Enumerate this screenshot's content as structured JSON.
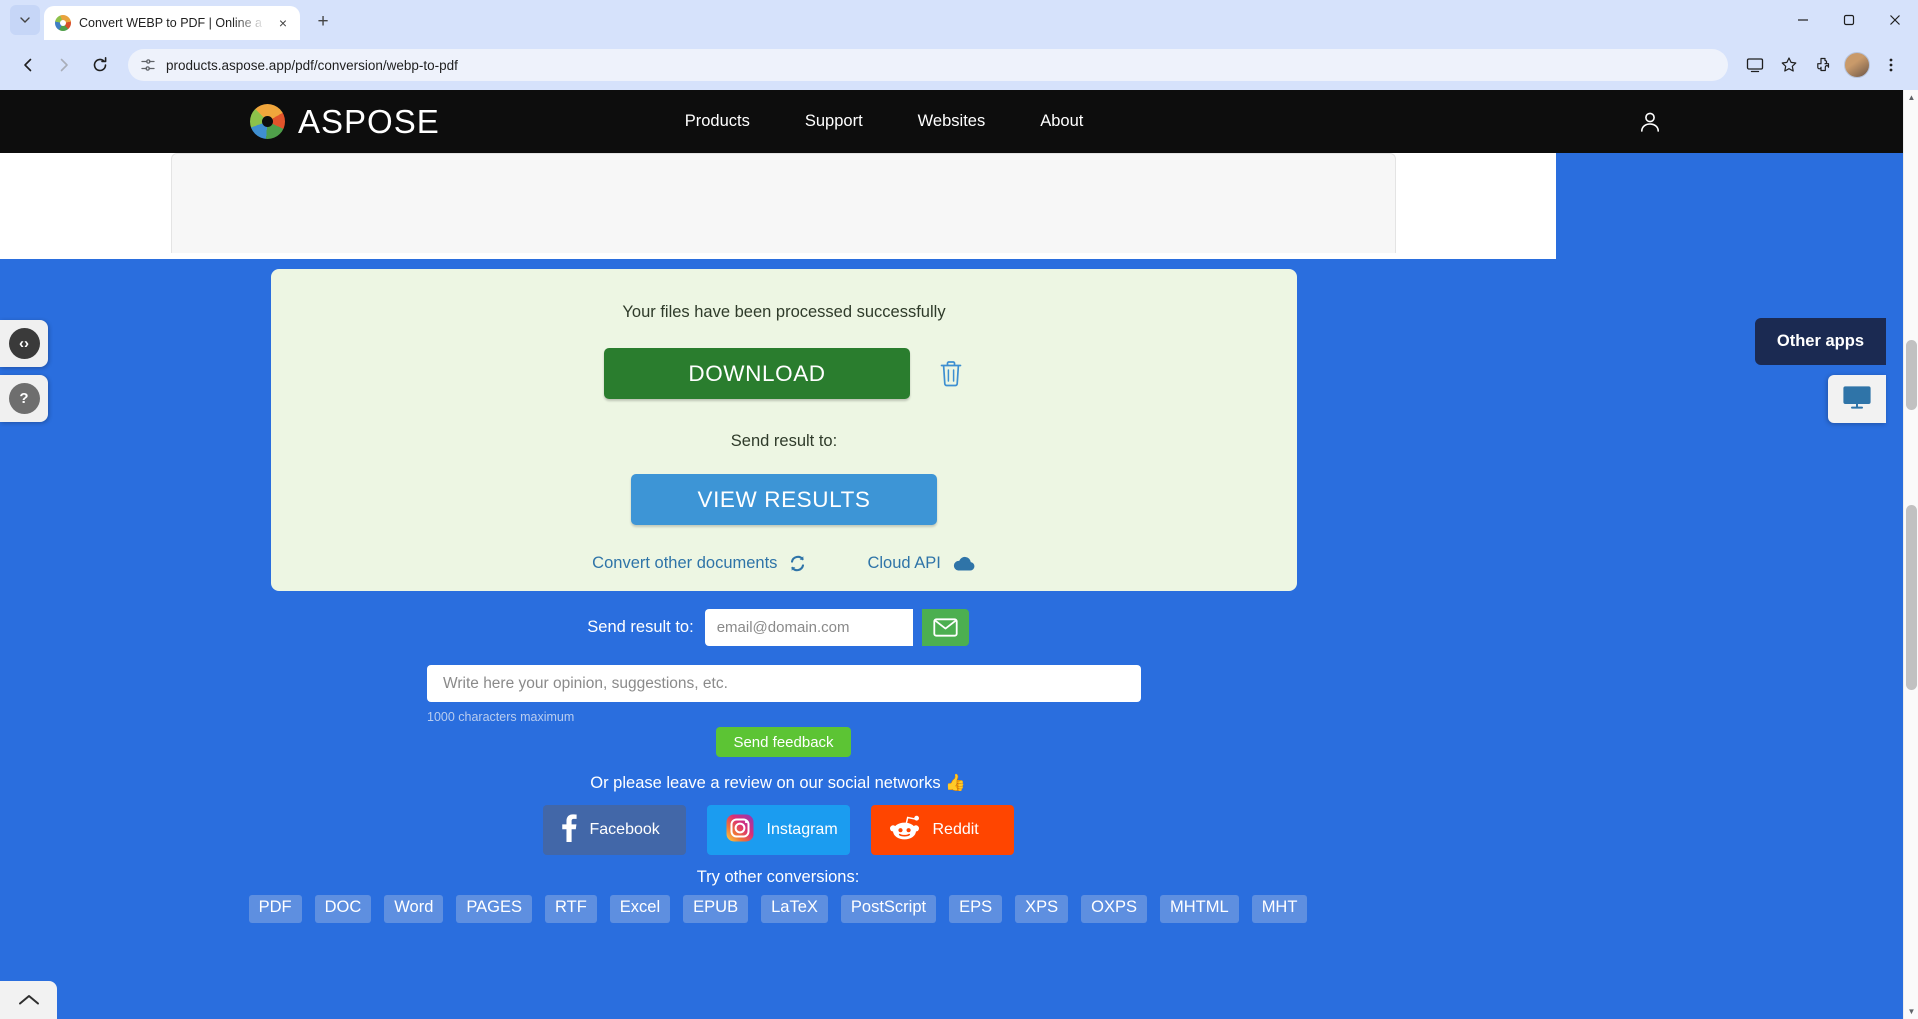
{
  "browser": {
    "tab": {
      "title": "Convert WEBP to PDF | Online a",
      "favicon": "aspose-logo-icon",
      "close": "×"
    },
    "new_tab": "+",
    "caret": "⌄",
    "window": {
      "minimize": "minimize-icon",
      "maximize": "maximize-icon",
      "close": "close-icon"
    },
    "toolbar": {
      "back": "back-arrow-icon",
      "forward": "forward-arrow-icon",
      "reload": "reload-icon",
      "site_info": "site-settings-icon",
      "url": "products.aspose.app/pdf/conversion/webp-to-pdf",
      "cast": "cast-icon",
      "bookmark": "star-icon",
      "extensions": "extensions-icon",
      "profile": "profile-avatar",
      "menu": "kebab-menu-icon"
    }
  },
  "site_header": {
    "brand": "ASPOSE",
    "nav": [
      {
        "label": "Products"
      },
      {
        "label": "Support"
      },
      {
        "label": "Websites"
      },
      {
        "label": "About"
      }
    ],
    "account": "user-account-icon"
  },
  "success_panel": {
    "message": "Your files have been processed successfully",
    "download_label": "DOWNLOAD",
    "delete_icon": "trash-icon",
    "send_result_label": "Send result to:",
    "view_results_label": "VIEW RESULTS",
    "links": [
      {
        "label": "Convert other documents",
        "icon": "refresh-icon"
      },
      {
        "label": "Cloud API",
        "icon": "cloud-icon"
      }
    ]
  },
  "email_form": {
    "label": "Send result to:",
    "placeholder": "email@domain.com",
    "value": "",
    "send_icon": "envelope-icon"
  },
  "feedback": {
    "placeholder": "Write here your opinion, suggestions, etc.",
    "value": "",
    "counter": "1000 characters maximum",
    "submit_label": "Send feedback"
  },
  "social": {
    "heading": "Or please leave a review on our social networks 👍",
    "buttons": [
      {
        "label": "Facebook",
        "icon": "facebook-icon",
        "color": "#4267a8"
      },
      {
        "label": "Instagram",
        "icon": "instagram-icon",
        "color": "#1b9cf0"
      },
      {
        "label": "Reddit",
        "icon": "reddit-icon",
        "color": "#ff4500"
      }
    ]
  },
  "conversions": {
    "heading": "Try other conversions:",
    "formats": [
      "PDF",
      "DOC",
      "Word",
      "PAGES",
      "RTF",
      "Excel",
      "EPUB",
      "LaTeX",
      "PostScript",
      "EPS",
      "XPS",
      "OXPS",
      "MHTML",
      "MHT"
    ]
  },
  "widgets": {
    "code_snippet": "code-brackets-icon",
    "help": "question-mark-icon",
    "other_apps": "Other apps",
    "monitor": "monitor-icon",
    "scroll_top": "chevron-up-icon"
  },
  "colors": {
    "page_blue": "#2a6ede",
    "panel_green": "#edf6e3",
    "download_green": "#2a7d2e",
    "view_blue": "#3d95d6",
    "feedback_green": "#5cc434",
    "header_black": "#0d0d0d"
  }
}
